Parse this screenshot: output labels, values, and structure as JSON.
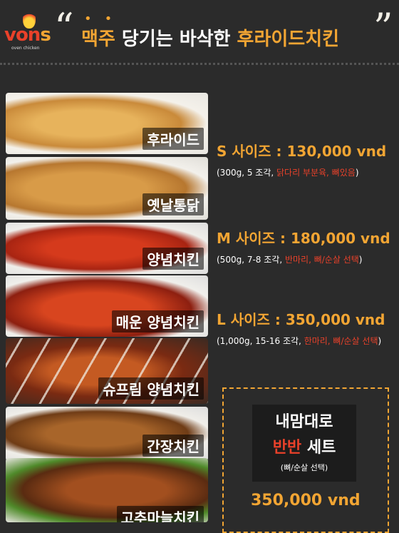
{
  "brand": {
    "logo_text_main": "von",
    "logo_text_accent": "s",
    "logo_subtext": "oven chicken"
  },
  "header": {
    "quote_open": "“",
    "quote_close": "”",
    "headline_part1": "맥주",
    "headline_part2": "당기는 바삭한",
    "headline_highlight": "후라이드치킨"
  },
  "menu_items": [
    {
      "label": "후라이드"
    },
    {
      "label": "옛날통닭"
    },
    {
      "label": "양념치킨"
    },
    {
      "label": "매운 양념치킨"
    },
    {
      "label": "슈프림 양념치킨"
    },
    {
      "label": "간장치킨"
    },
    {
      "label": "고추마늘치킨"
    }
  ],
  "sizes": [
    {
      "title": "S 사이즈 : 130,000 vnd",
      "detail_plain": "(300g, 5 조각, ",
      "detail_red": "닭다리 부분육, 뼈있음",
      "detail_end": ")"
    },
    {
      "title": "M  사이즈 : 180,000 vnd",
      "detail_plain": "(500g, 7-8 조각, ",
      "detail_red": "반마리, 뼈/순살 선택",
      "detail_end": ")"
    },
    {
      "title": "L  사이즈 : 350,000 vnd",
      "detail_plain": "(1,000g, 15-16 조각, ",
      "detail_red": "한마리, 뼈/순살 선택",
      "detail_end": ")"
    }
  ],
  "set": {
    "line1": "내맘대로",
    "line2_highlight": "반반",
    "line2_rest": " 세트",
    "line3": "(뼈/순살 선택)",
    "price": "350,000 vnd"
  },
  "colors": {
    "background": "#2b2b2b",
    "accent_orange": "#f2a533",
    "accent_red": "#e9412a"
  }
}
